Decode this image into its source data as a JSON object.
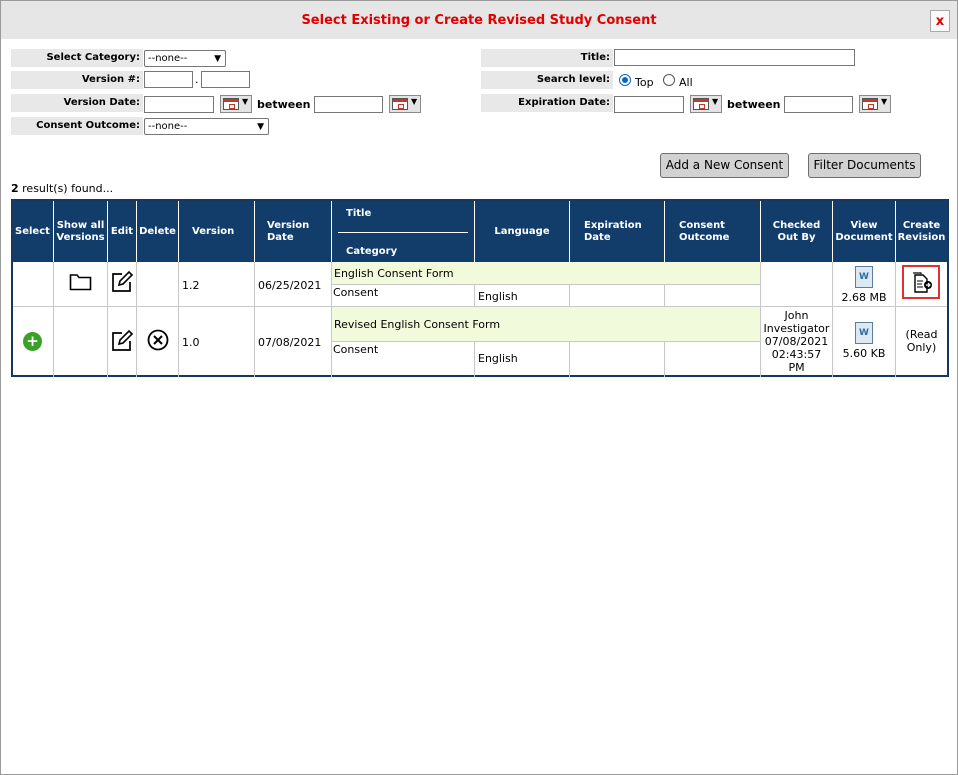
{
  "dialog": {
    "title": "Select Existing or Create Revised Study Consent",
    "close_label": "x"
  },
  "filters": {
    "category_label": "Select Category:",
    "category_value": "--none--",
    "version_label": "Version #:",
    "version_sep": ".",
    "version_date_label": "Version Date:",
    "between_label": "between",
    "outcome_label": "Consent Outcome:",
    "outcome_value": "--none--",
    "title_label": "Title:",
    "search_level_label": "Search level:",
    "search_level_options": [
      "Top",
      "All"
    ],
    "search_level_selected": "Top",
    "expiration_label": "Expiration Date:"
  },
  "actions": {
    "add_label": "Add a New Consent",
    "filter_label": "Filter Documents"
  },
  "results": {
    "count": "2",
    "found_text": "result(s) found..."
  },
  "table": {
    "headers": {
      "select": "Select",
      "show_all": [
        "Show all",
        "Versions"
      ],
      "edit": "Edit",
      "delete": "Delete",
      "version": "Version",
      "version_date": [
        "Version",
        "Date"
      ],
      "title": "Title",
      "category": "Category",
      "language": "Language",
      "expiration": [
        "Expiration",
        "Date"
      ],
      "outcome": [
        "Consent",
        "Outcome"
      ],
      "checked_out": [
        "Checked",
        "Out By"
      ],
      "view_doc": [
        "View",
        "Document"
      ],
      "create_rev": [
        "Create",
        "Revision"
      ]
    },
    "rows": [
      {
        "version": "1.2",
        "version_date": "06/25/2021",
        "title": "English Consent Form",
        "category": "Consent",
        "language": "English",
        "expiration": "",
        "outcome": "",
        "checked_out": [],
        "doc_size": "2.68 MB",
        "revision_text": []
      },
      {
        "version": "1.0",
        "version_date": "07/08/2021",
        "title": "Revised English Consent Form",
        "category": "Consent",
        "language": "English",
        "expiration": "",
        "outcome": "",
        "checked_out": [
          "John",
          "Investigator",
          "07/08/2021",
          "02:43:57",
          "PM"
        ],
        "doc_size": "5.60 KB",
        "revision_text": [
          "(Read",
          "Only)"
        ]
      }
    ]
  },
  "colors": {
    "title_red": "#e00000",
    "header_navy": "#123d6b",
    "row_green": "#f2fadc",
    "highlight_red": "#e03030"
  }
}
